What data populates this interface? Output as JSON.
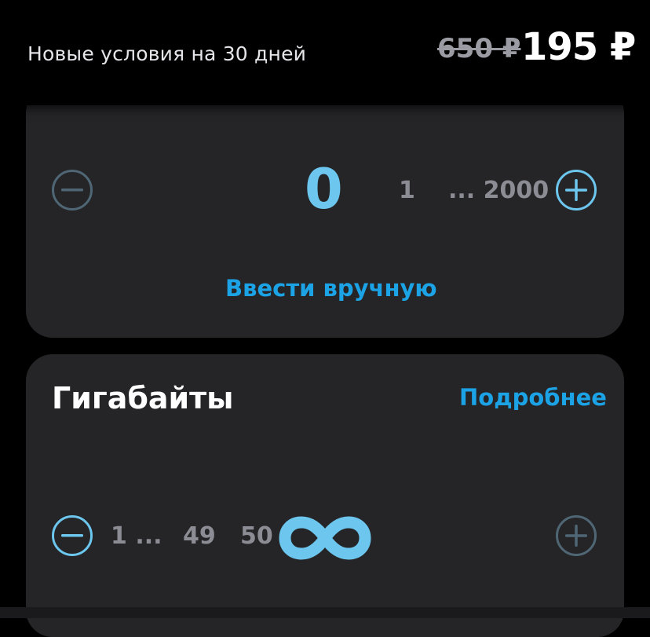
{
  "header": {
    "title": "Новые условия на 30 дней",
    "old_price": "650 ₽",
    "new_price": "195 ₽"
  },
  "minutes": {
    "current_value": "0",
    "next_value": "1",
    "max_value": "... 2000",
    "manual_entry_label": "Ввести вручную"
  },
  "gigabytes": {
    "title": "Гигабайты",
    "details_link": "Подробнее",
    "options": [
      "1 ...",
      "49",
      "50"
    ],
    "selected_icon": "infinity-icon"
  },
  "colors": {
    "accent": "#1ba3e6",
    "accent_light": "#6cc6ee",
    "card_bg": "#252528",
    "disabled_stroke": "#4f6674"
  }
}
